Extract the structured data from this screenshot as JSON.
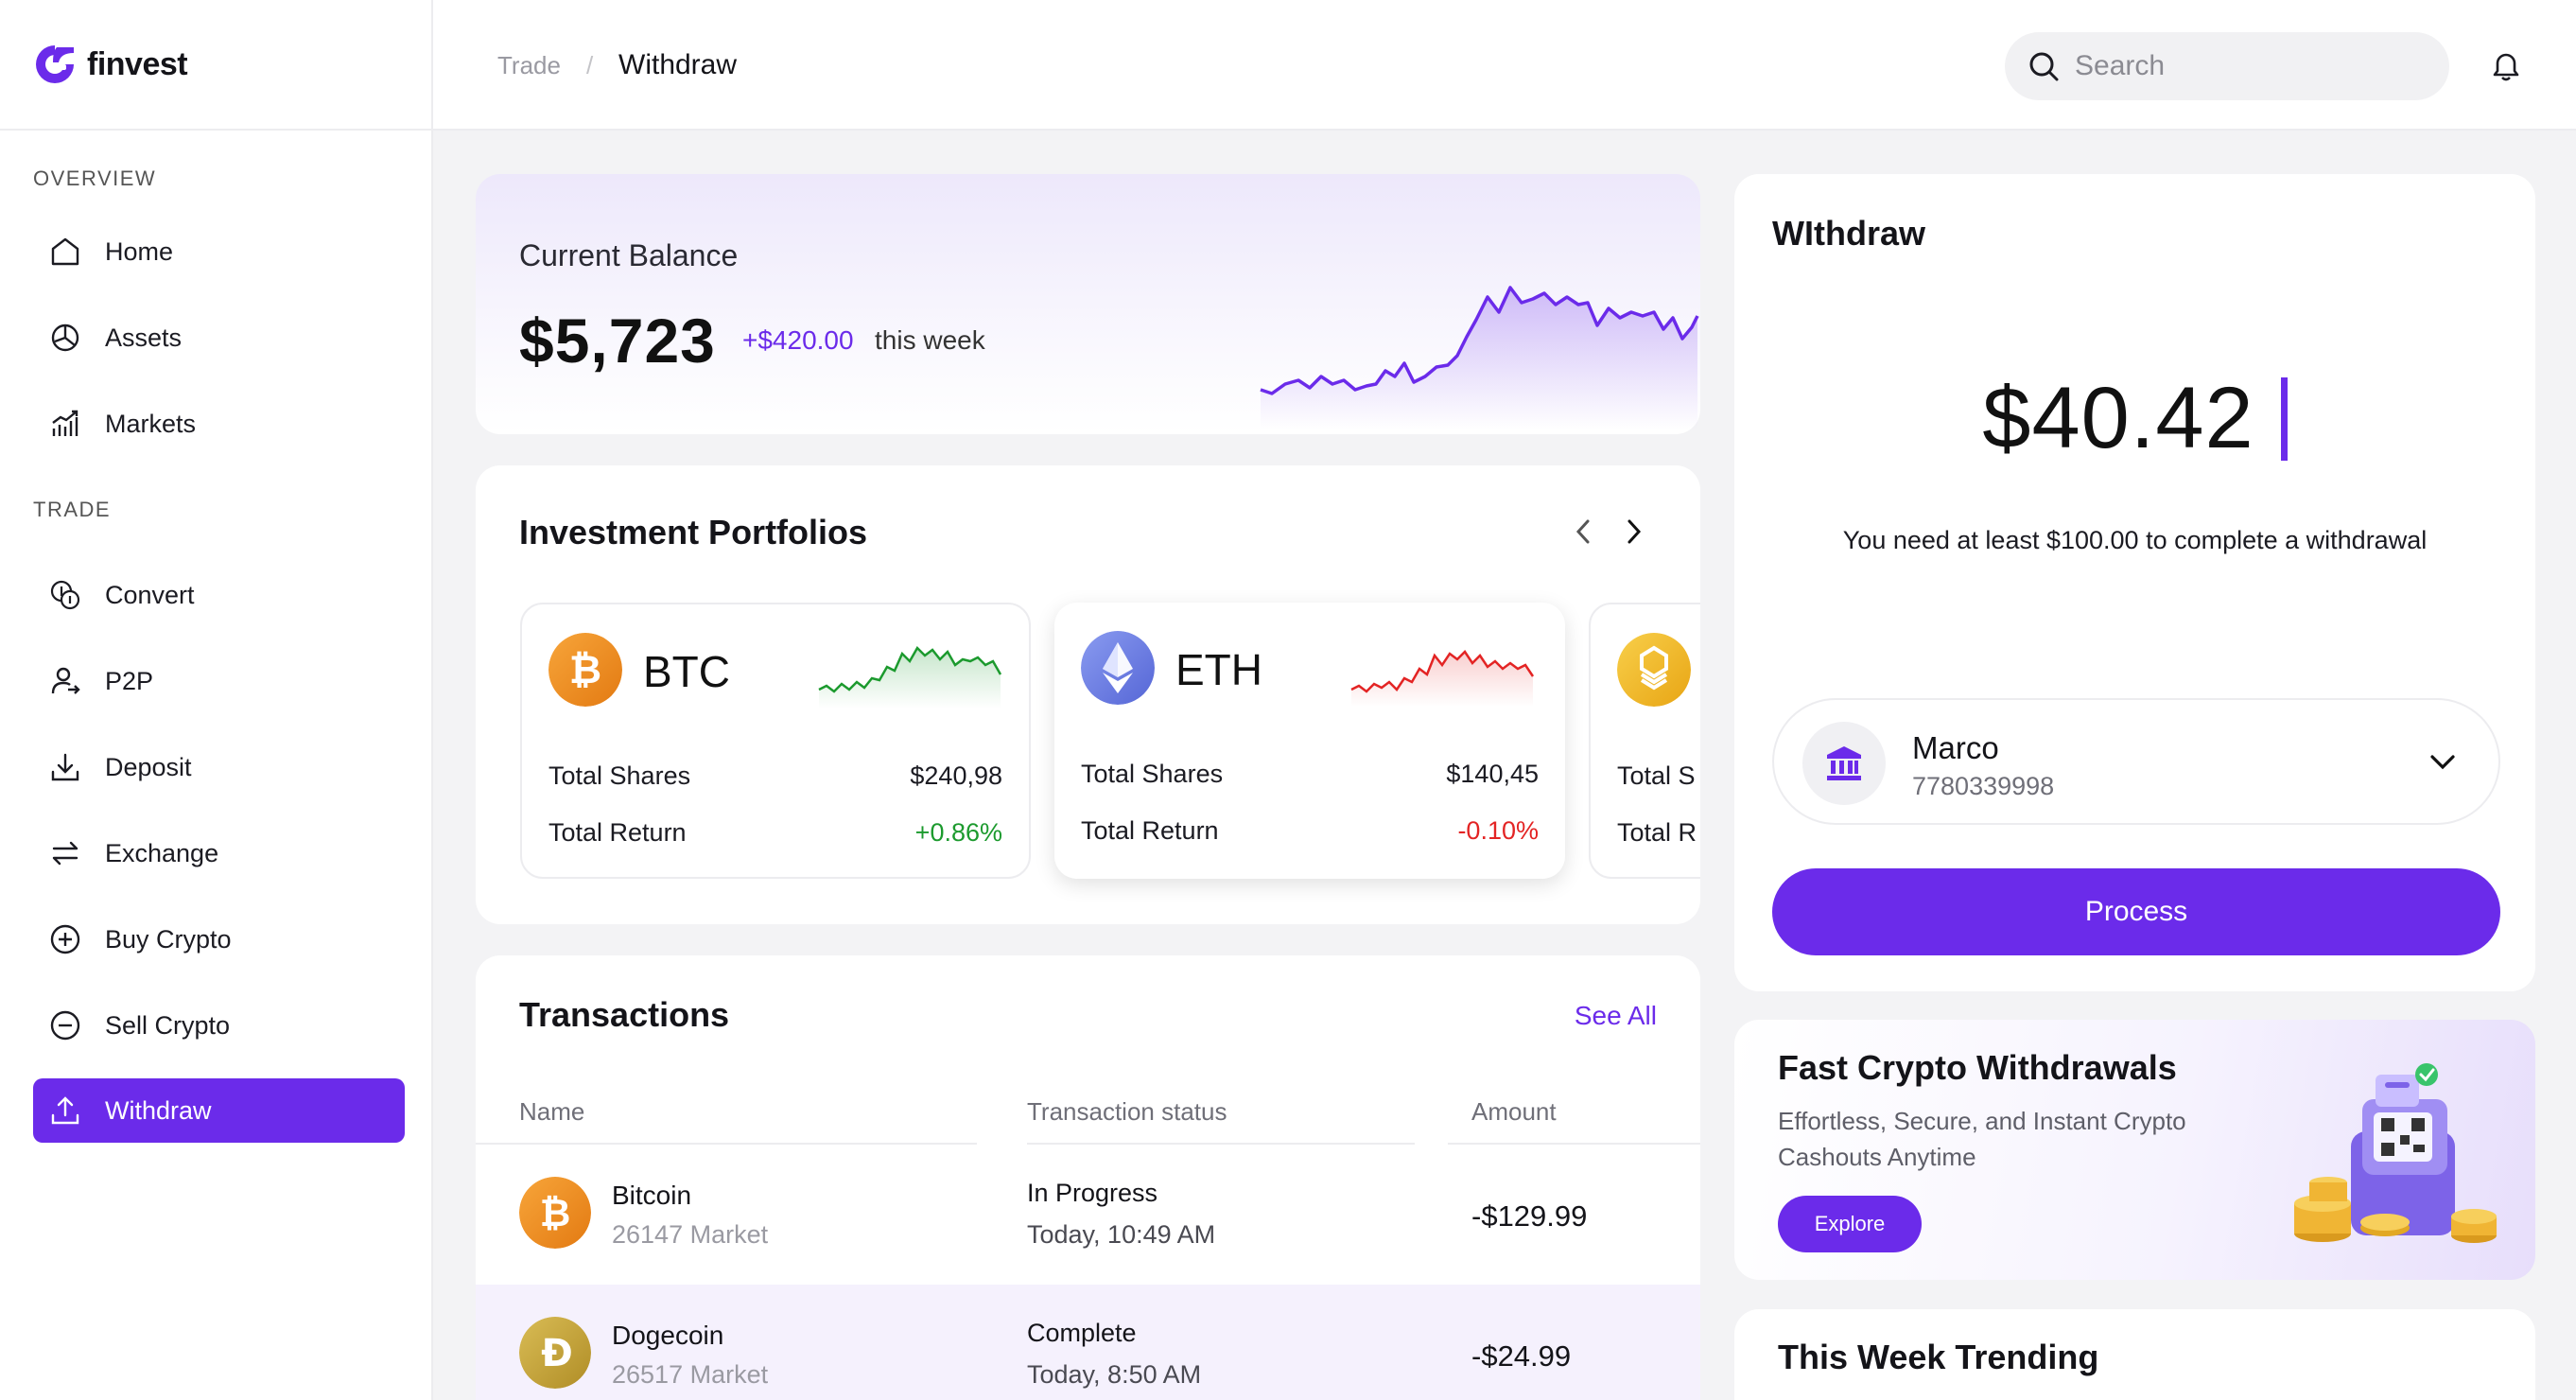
{
  "brand": {
    "name": "finvest"
  },
  "sidebar": {
    "sections": [
      {
        "label": "OVERVIEW"
      },
      {
        "label": "TRADE"
      }
    ],
    "items": [
      {
        "label": "Home",
        "icon": "home-icon"
      },
      {
        "label": "Assets",
        "icon": "pie-chart-icon"
      },
      {
        "label": "Markets",
        "icon": "bar-chart-icon"
      },
      {
        "label": "Convert",
        "icon": "coins-icon"
      },
      {
        "label": "P2P",
        "icon": "user-transfer-icon"
      },
      {
        "label": "Deposit",
        "icon": "download-icon"
      },
      {
        "label": "Exchange",
        "icon": "swap-icon"
      },
      {
        "label": "Buy Crypto",
        "icon": "plus-circle-icon"
      },
      {
        "label": "Sell Crypto",
        "icon": "minus-circle-icon"
      },
      {
        "label": "Withdraw",
        "icon": "upload-icon",
        "active": true
      }
    ]
  },
  "header": {
    "breadcrumb": {
      "parent": "Trade",
      "separator": "/",
      "current": "Withdraw"
    },
    "search": {
      "placeholder": "Search",
      "value": ""
    }
  },
  "balance": {
    "label": "Current Balance",
    "value": "$5,723",
    "change": "+$420.00",
    "change_suffix": "this week"
  },
  "portfolios": {
    "title": "Investment Portfolios",
    "cards": [
      {
        "symbol": "BTC",
        "shares_label": "Total Shares",
        "shares": "$240,98",
        "return_label": "Total Return",
        "return": "+0.86%",
        "trend": "up"
      },
      {
        "symbol": "ETH",
        "shares_label": "Total Shares",
        "shares": "$140,45",
        "return_label": "Total Return",
        "return": "-0.10%",
        "trend": "down"
      },
      {
        "symbol": "BNB",
        "shares_label": "Total S",
        "return_label": "Total R"
      }
    ]
  },
  "transactions": {
    "title": "Transactions",
    "see_all": "See All",
    "columns": [
      "Name",
      "Transaction status",
      "Amount"
    ],
    "rows": [
      {
        "name": "Bitcoin",
        "market": "26147 Market",
        "status": "In Progress",
        "time": "Today, 10:49 AM",
        "amount": "-$129.99"
      },
      {
        "name": "Dogecoin",
        "market": "26517 Market",
        "status": "Complete",
        "time": "Today, 8:50 AM",
        "amount": "-$24.99"
      }
    ]
  },
  "withdraw": {
    "title": "WIthdraw",
    "amount": "$40.42",
    "note": "You need at least $100.00 to complete a withdrawal",
    "account": {
      "name": "Marco",
      "number": "7780339998"
    },
    "process_label": "Process"
  },
  "promo": {
    "title": "Fast Crypto Withdrawals",
    "subtitle": "Effortless, Secure, and Instant Crypto Cashouts Anytime",
    "button": "Explore"
  },
  "trending": {
    "title": "This Week Trending"
  },
  "colors": {
    "accent": "#6b2bea",
    "positive": "#1c9a2e",
    "negative": "#e32424",
    "btc": "#f0921e",
    "eth": "#6d7fe3",
    "bnb": "#f3ba2f",
    "doge": "#c9a83a"
  }
}
